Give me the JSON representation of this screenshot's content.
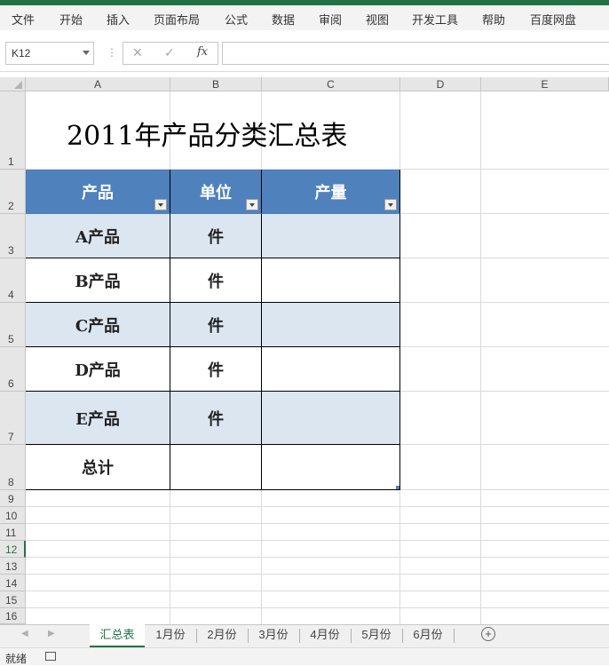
{
  "ribbon": {
    "tabs": [
      "文件",
      "开始",
      "插入",
      "页面布局",
      "公式",
      "数据",
      "审阅",
      "视图",
      "开发工具",
      "帮助",
      "百度网盘"
    ]
  },
  "formula_bar": {
    "name_box": "K12",
    "cancel_icon": "✕",
    "enter_icon": "✓",
    "fx_label": "fx",
    "formula": ""
  },
  "columns": [
    "A",
    "B",
    "C",
    "D",
    "E"
  ],
  "rows": [
    "1",
    "2",
    "3",
    "4",
    "5",
    "6",
    "7",
    "8",
    "9",
    "10",
    "11",
    "12",
    "13",
    "14",
    "15",
    "16"
  ],
  "sheet": {
    "title": "2011年产品分类汇总表",
    "headers": [
      "产品",
      "单位",
      "产量"
    ],
    "body": [
      [
        "A产品",
        "件",
        ""
      ],
      [
        "B产品",
        "件",
        ""
      ],
      [
        "C产品",
        "件",
        ""
      ],
      [
        "D产品",
        "件",
        ""
      ],
      [
        "E产品",
        "件",
        ""
      ],
      [
        "总计",
        "",
        ""
      ]
    ]
  },
  "sheet_tabs": [
    "汇总表",
    "1月份",
    "2月份",
    "3月份",
    "4月份",
    "5月份",
    "6月份"
  ],
  "active_sheet": "汇总表",
  "status": "就绪",
  "colors": {
    "accent": "#217346",
    "header_fill": "#4f81bd",
    "band_fill": "#dce6f1"
  }
}
